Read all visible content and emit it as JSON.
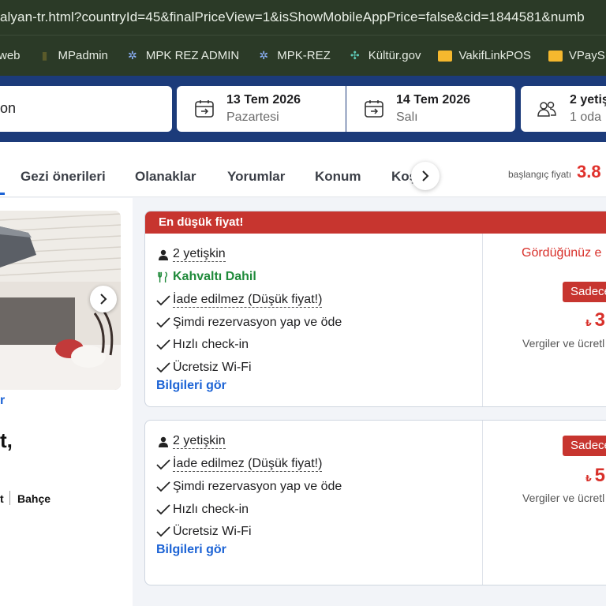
{
  "browser": {
    "url_fragment": "alyan-tr.html?countryId=45&finalPriceView=1&isShowMobileAppPrice=false&cid=1844581&numb",
    "bookmarks": [
      {
        "label": "web",
        "icon": "web-icon"
      },
      {
        "label": "MPadmin",
        "icon": "mpadmin-icon"
      },
      {
        "label": "MPK REZ ADMIN",
        "icon": "snowflake-icon"
      },
      {
        "label": "MPK-REZ",
        "icon": "snowflake-icon"
      },
      {
        "label": "Kültür.gov",
        "icon": "gov-icon"
      },
      {
        "label": "VakifLinkPOS",
        "icon": "folder-icon"
      },
      {
        "label": "VPayS",
        "icon": "folder-icon"
      }
    ]
  },
  "search": {
    "destination_fragment": "on",
    "checkin_date": "13 Tem 2026",
    "checkin_day": "Pazartesi",
    "checkout_date": "14 Tem 2026",
    "checkout_day": "Salı",
    "guests_adults": "2 yetiş",
    "guests_rooms": "1 oda"
  },
  "tabs": {
    "items": [
      "Gezi önerileri",
      "Olanaklar",
      "Yorumlar",
      "Konum",
      "Koş"
    ],
    "price_from_label": "başlangıç fiyatı",
    "price_from_value": "3.8"
  },
  "left": {
    "photo_link_fragment": "r",
    "hotel_name_fragment": "t,",
    "amenity_fragment": "t",
    "amenity_garden": "Bahçe"
  },
  "offers": [
    {
      "banner": "En düşük fiyat!",
      "features": [
        {
          "text": "2 yetişkin",
          "type": "guests"
        },
        {
          "text": "Kahvaltı Dahil",
          "type": "meal"
        },
        {
          "text": "İade edilmez (Düşük fiyat!)",
          "type": "check"
        },
        {
          "text": "Şimdi rezervasyon yap ve öde",
          "type": "check"
        },
        {
          "text": "Hızlı check-in",
          "type": "check"
        },
        {
          "text": "Ücretsiz Wi-Fi",
          "type": "check"
        }
      ],
      "info_link": "Bilgileri gör",
      "seen_text": "Gördüğünüz e",
      "only_badge": "Sadece",
      "currency": "₺",
      "price_fragment": "3",
      "tax_note": "Vergiler ve ücretl"
    },
    {
      "features": [
        {
          "text": "2 yetişkin",
          "type": "guests"
        },
        {
          "text": "İade edilmez (Düşük fiyat!)",
          "type": "check"
        },
        {
          "text": "Şimdi rezervasyon yap ve öde",
          "type": "check"
        },
        {
          "text": "Hızlı check-in",
          "type": "check"
        },
        {
          "text": "Ücretsiz Wi-Fi",
          "type": "check"
        }
      ],
      "info_link": "Bilgileri gör",
      "only_badge": "Sadece",
      "currency": "₺",
      "price_fragment": "5",
      "tax_note": "Vergiler ve ücretl"
    }
  ],
  "colors": {
    "chrome_bg": "#2b3a27",
    "search_bg": "#1c3b7a",
    "accent_blue": "#1c63d5",
    "price_red": "#d8302a",
    "badge_red": "#c7352f",
    "meal_green": "#1f8a3a"
  }
}
